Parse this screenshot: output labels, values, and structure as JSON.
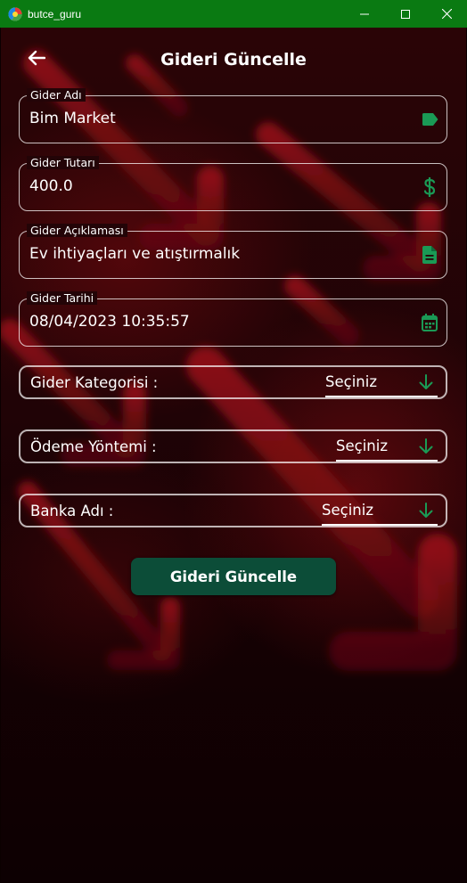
{
  "window": {
    "title": "butce_guru",
    "controls": [
      "minimize-icon",
      "maximize-icon",
      "close-icon"
    ]
  },
  "header": {
    "back_icon": "arrow-left-icon",
    "title": "Gideri Güncelle"
  },
  "form": {
    "name": {
      "label": "Gider Adı",
      "value": "Bim Market",
      "icon": "label-tag-icon"
    },
    "amount": {
      "label": "Gider Tutarı",
      "value": "400.0",
      "icon": "dollar-icon"
    },
    "description": {
      "label": "Gider Açıklaması",
      "value": "Ev ihtiyaçları ve atıştırmalık",
      "icon": "document-icon"
    },
    "date": {
      "label": "Gider Tarihi",
      "value": "08/04/2023 10:35:57",
      "icon": "calendar-icon"
    }
  },
  "selects": {
    "category": {
      "label": "Gider Kategorisi :",
      "value": "Seçiniz",
      "icon": "arrow-down-icon"
    },
    "payment": {
      "label": "Ödeme Yöntemi :",
      "value": "Seçiniz",
      "icon": "arrow-down-icon"
    },
    "bank": {
      "label": "Banka Adı :",
      "value": "Seçiniz",
      "icon": "arrow-down-icon"
    }
  },
  "submit": {
    "label": "Gideri Güncelle"
  },
  "colors": {
    "titlebar": "#0a7a12",
    "accent_green": "#1a9a55",
    "button_bg": "#0c4d38",
    "background_dark": "#0b0000",
    "background_red": "#2a0406"
  }
}
